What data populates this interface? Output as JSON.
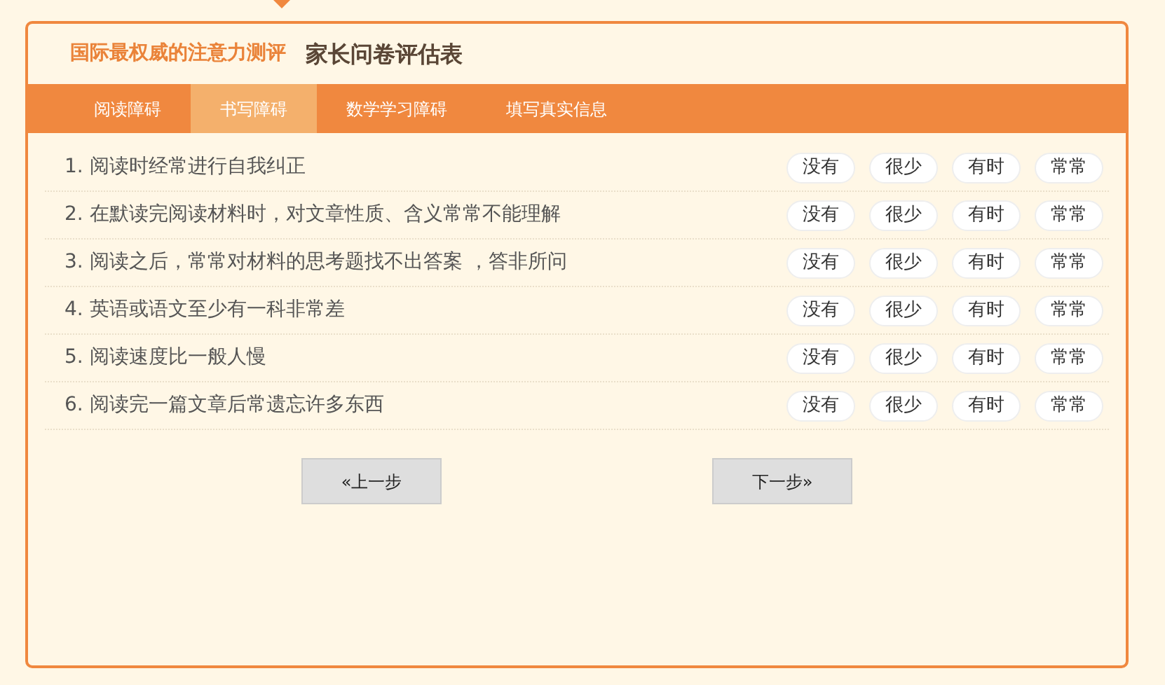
{
  "header": {
    "brand": "国际最权威的注意力测评",
    "title": "家长问卷评估表"
  },
  "tabs": [
    {
      "label": "阅读障碍",
      "selected": false
    },
    {
      "label": "书写障碍",
      "selected": true
    },
    {
      "label": "数学学习障碍",
      "selected": false
    },
    {
      "label": "填写真实信息",
      "selected": false
    }
  ],
  "questions": [
    {
      "number": "1.",
      "text": "阅读时经常进行自我纠正",
      "options": [
        {
          "label": "没有",
          "selected": false
        },
        {
          "label": "很少",
          "selected": false
        },
        {
          "label": "有时",
          "selected": false
        },
        {
          "label": "常常",
          "selected": false
        }
      ]
    },
    {
      "number": "2.",
      "text": "在默读完阅读材料时，对文章性质、含义常常不能理解",
      "options": [
        {
          "label": "没有",
          "selected": false
        },
        {
          "label": "很少",
          "selected": false
        },
        {
          "label": "有时",
          "selected": false
        },
        {
          "label": "常常",
          "selected": false
        }
      ]
    },
    {
      "number": "3.",
      "text": "阅读之后，常常对材料的思考题找不出答案 ，答非所问",
      "options": [
        {
          "label": "没有",
          "selected": false
        },
        {
          "label": "很少",
          "selected": false
        },
        {
          "label": "有时",
          "selected": false
        },
        {
          "label": "常常",
          "selected": false
        }
      ]
    },
    {
      "number": "4.",
      "text": "英语或语文至少有一科非常差",
      "options": [
        {
          "label": "没有",
          "selected": false
        },
        {
          "label": "很少",
          "selected": false
        },
        {
          "label": "有时",
          "selected": false
        },
        {
          "label": "常常",
          "selected": false
        }
      ]
    },
    {
      "number": "5.",
      "text": "阅读速度比一般人慢",
      "options": [
        {
          "label": "没有",
          "selected": false
        },
        {
          "label": "很少",
          "selected": false
        },
        {
          "label": "有时",
          "selected": false
        },
        {
          "label": "常常",
          "selected": false
        }
      ]
    },
    {
      "number": "6.",
      "text": "阅读完一篇文章后常遗忘许多东西",
      "options": [
        {
          "label": "没有",
          "selected": false
        },
        {
          "label": "很少",
          "selected": false
        },
        {
          "label": "有时",
          "selected": false
        },
        {
          "label": "常常",
          "selected": false
        }
      ]
    }
  ],
  "buttons": {
    "prev": "«上一步",
    "next": "下一步»"
  }
}
